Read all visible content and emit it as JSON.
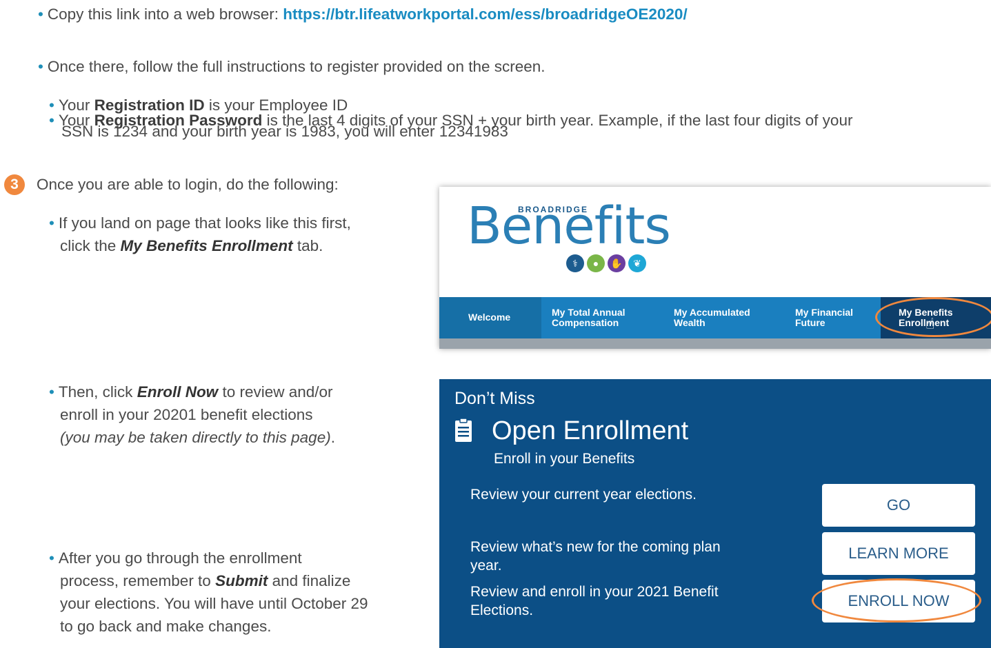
{
  "instructions": {
    "copy_link_prefix": "Copy this link into a web browser: ",
    "link": "https://btr.lifeatworkportal.com/ess/broadridgeOE2020/",
    "once_there": "Once there, follow the full instructions to register provided on the screen.",
    "reg_id_prefix": "Your ",
    "reg_id_term": "Registration ID",
    "reg_id_suffix": " is your Employee ID",
    "reg_pw_prefix": "Your ",
    "reg_pw_term": "Registration Password",
    "reg_pw_suffix": " is the last 4 digits of your SSN + your birth year. Example, if the last four digits of your",
    "reg_pw_line2": "SSN is 1234 and your birth year is 1983, you will enter 12341983",
    "step_number": "3",
    "step_text": "Once you are able to login, do the following:",
    "landing_line1": "If you land on page that looks like this first,",
    "landing_line2_prefix": "click the ",
    "landing_term": "My Benefits Enrollment",
    "landing_line2_suffix": " tab.",
    "then_prefix": "Then, click ",
    "then_term": "Enroll Now",
    "then_suffix": " to review and/or",
    "then_line2": "enroll in your 20201 benefit elections",
    "then_line3_italic": "(you may be taken directly to this page)",
    "then_line3_end": ".",
    "after_line1": "After you go through the enrollment",
    "after_line2_prefix": "process, remember to ",
    "after_term": "Submit",
    "after_line2_suffix": " and finalize",
    "after_line3": "your elections. You will have until October 29",
    "after_line4": "to go back and make changes."
  },
  "benefits_portal": {
    "logo_small": "BROADRIDGE",
    "logo_large": "Benefits",
    "icons": [
      "stethoscope-icon",
      "piggy-bank-icon",
      "hands-icon",
      "seedling-icon"
    ],
    "colors": {
      "nav": "#1a7fbf",
      "nav_active": "#0e3e6a",
      "highlight": "#f0883e"
    },
    "nav": {
      "welcome": "Welcome",
      "total_comp_1": "My Total Annual",
      "total_comp_2": "Compensation",
      "accum_1": "My Accumulated",
      "accum_2": "Wealth",
      "financial_1": "My Financial",
      "financial_2": "Future",
      "enroll_1": "My Benefits",
      "enroll_2": "Enrollment"
    }
  },
  "enrollment_panel": {
    "dont_miss": "Don’t Miss",
    "title": "Open Enrollment",
    "subtitle": "Enroll in your Benefits",
    "review_current": "Review your current year elections.",
    "review_new_1": "Review what’s new for the coming plan",
    "review_new_2": "year.",
    "review_enroll_1": "Review and enroll in your 2021 Benefit",
    "review_enroll_2": "Elections.",
    "btn_go": "GO",
    "btn_learn": "LEARN MORE",
    "btn_enroll": "ENROLL NOW",
    "colors": {
      "panel_bg": "#0c4f86"
    }
  }
}
